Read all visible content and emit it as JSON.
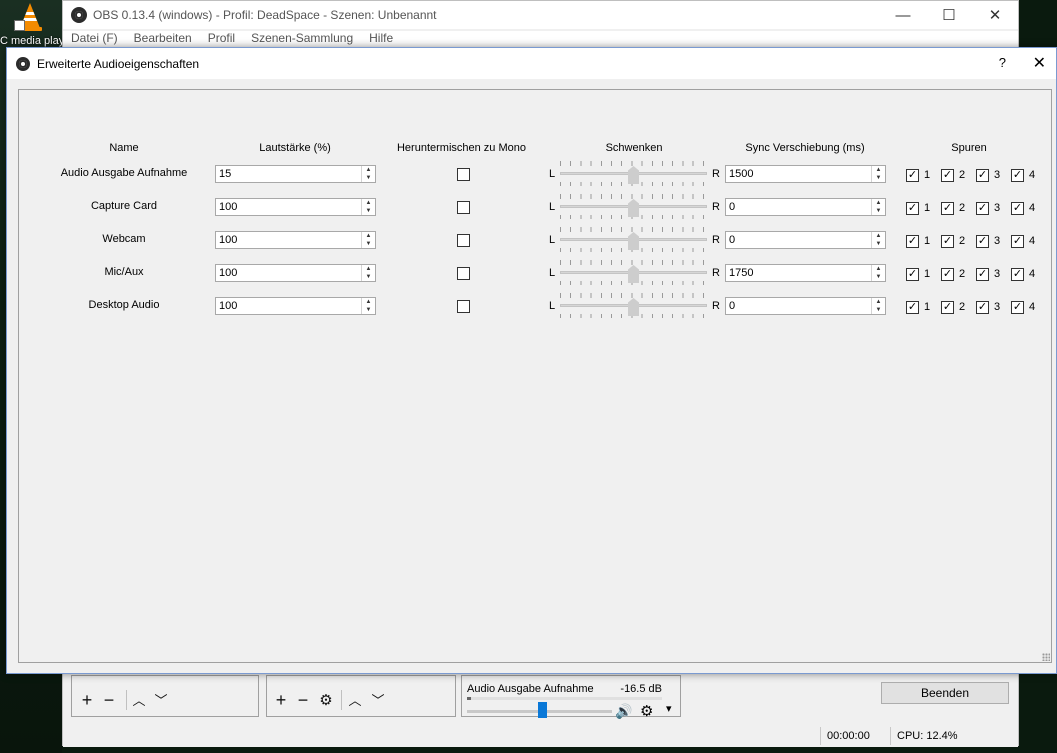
{
  "desktop": {
    "vlc_label": "C media play"
  },
  "obs": {
    "title": "OBS 0.13.4 (windows) - Profil: DeadSpace - Szenen: Unbenannt",
    "menu": [
      "Datei (F)",
      "Bearbeiten",
      "Profil",
      "Szenen-Sammlung",
      "Hilfe"
    ],
    "mixer": {
      "source": "Audio Ausgabe Aufnahme",
      "level": "-16.5 dB",
      "volume_fraction": 0.52
    },
    "stop_button": "Beenden",
    "status": {
      "time": "00:00:00",
      "cpu": "CPU: 12.4%"
    }
  },
  "dialog": {
    "title": "Erweiterte Audioeigenschaften",
    "help": "?",
    "close": "✕",
    "headers": {
      "name": "Name",
      "volume": "Lautstärke (%)",
      "mono": "Heruntermischen zu Mono",
      "balance": "Schwenken",
      "sync": "Sync Verschiebung (ms)",
      "tracks": "Spuren"
    },
    "pan_left": "L",
    "pan_right": "R",
    "track_labels": [
      "1",
      "2",
      "3",
      "4"
    ],
    "rows": [
      {
        "name": "Audio Ausgabe Aufnahme",
        "volume": "15",
        "mono": false,
        "balance": 0.5,
        "sync": "1500",
        "tracks": [
          true,
          true,
          true,
          true
        ]
      },
      {
        "name": "Capture Card",
        "volume": "100",
        "mono": false,
        "balance": 0.5,
        "sync": "0",
        "tracks": [
          true,
          true,
          true,
          true
        ]
      },
      {
        "name": "Webcam",
        "volume": "100",
        "mono": false,
        "balance": 0.5,
        "sync": "0",
        "tracks": [
          true,
          true,
          true,
          true
        ]
      },
      {
        "name": "Mic/Aux",
        "volume": "100",
        "mono": false,
        "balance": 0.5,
        "sync": "1750",
        "tracks": [
          true,
          true,
          true,
          true
        ]
      },
      {
        "name": "Desktop Audio",
        "volume": "100",
        "mono": false,
        "balance": 0.5,
        "sync": "0",
        "tracks": [
          true,
          true,
          true,
          true
        ]
      }
    ]
  }
}
